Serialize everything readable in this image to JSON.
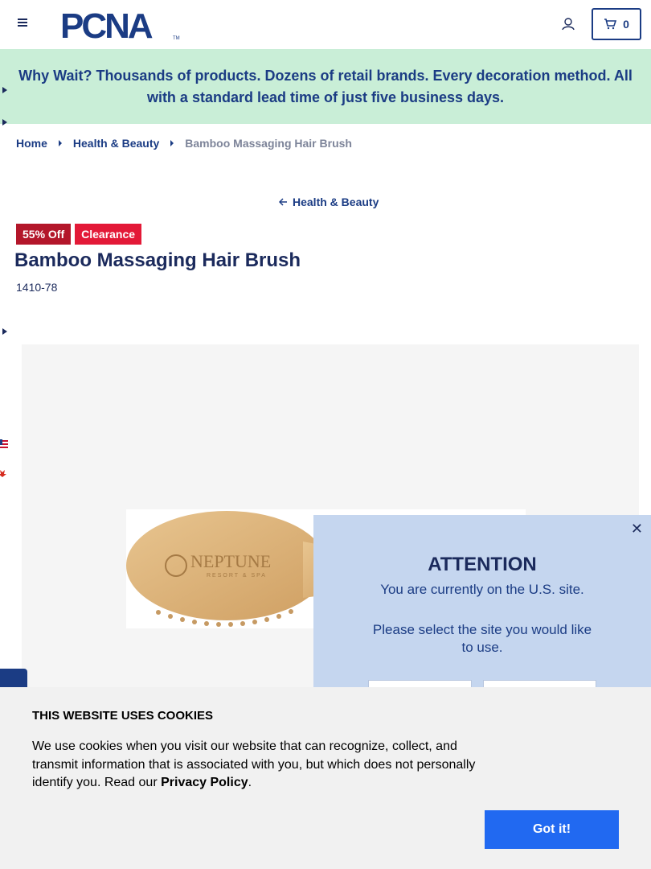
{
  "header": {
    "logo_text": "PCNA",
    "cart_count": "0"
  },
  "promo": {
    "text": "Why Wait? Thousands of products. Dozens of retail brands. Every decoration method. All with a standard lead time of just five business days."
  },
  "breadcrumb": {
    "items": [
      "Home",
      "Health & Beauty"
    ],
    "current": "Bamboo Massaging Hair Brush"
  },
  "back_link": "Health & Beauty",
  "product": {
    "badges": [
      "55% Off",
      "Clearance"
    ],
    "title": "Bamboo Massaging Hair Brush",
    "sku": "1410-78",
    "image_brand_text": "NEPTUNE",
    "image_brand_sub": "RESORT & SPA"
  },
  "modal": {
    "title": "ATTENTION",
    "line1": "You are currently on the U.S. site.",
    "line2": "Please select the site you would like to use."
  },
  "cookie": {
    "title": "THIS WEBSITE USES COOKIES",
    "text": "We use cookies when you visit our website that can recognize, collect, and transmit information that is associated with you, but which does not personally identify you. Read our ",
    "link": "Privacy Policy",
    "after_link": ".",
    "button": "Got it!"
  },
  "colors": {
    "brand_navy": "#1b3c84",
    "promo_bg": "#c9eed7",
    "clearance_red": "#e31937",
    "cookie_button": "#2169f1",
    "modal_bg": "#c5d6ef"
  }
}
